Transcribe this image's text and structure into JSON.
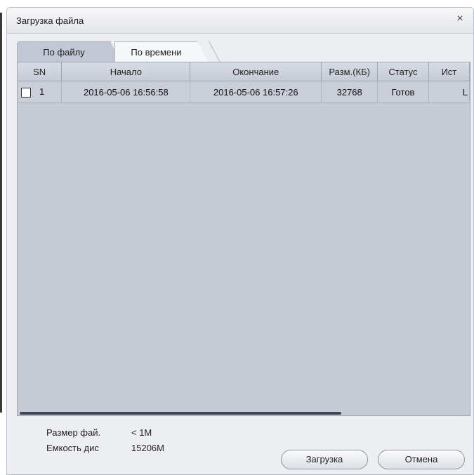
{
  "window": {
    "title": "Загрузка файла",
    "close_glyph": "×"
  },
  "tabs": [
    {
      "label": "По файлу",
      "active": true
    },
    {
      "label": "По времени",
      "active": false
    }
  ],
  "table": {
    "columns": [
      "SN",
      "Начало",
      "Окончание",
      "Разм.(КБ)",
      "Статус",
      "Ист"
    ],
    "rows": [
      {
        "checked": false,
        "sn": "1",
        "start": "2016-05-06 16:56:58",
        "end": "2016-05-06 16:57:26",
        "size": "32768",
        "status": "Готов",
        "source": "L"
      }
    ]
  },
  "info": {
    "file_size_label": "Размер фай.",
    "file_size_value": "< 1M",
    "disk_capacity_label": "Емкость дис",
    "disk_capacity_value": "15206M"
  },
  "buttons": {
    "download": "Загрузка",
    "cancel": "Отмена"
  },
  "colors": {
    "panel": "#c5cad4",
    "active_tab": "#c1c7d3",
    "scroll_thumb": "#3f4756"
  }
}
